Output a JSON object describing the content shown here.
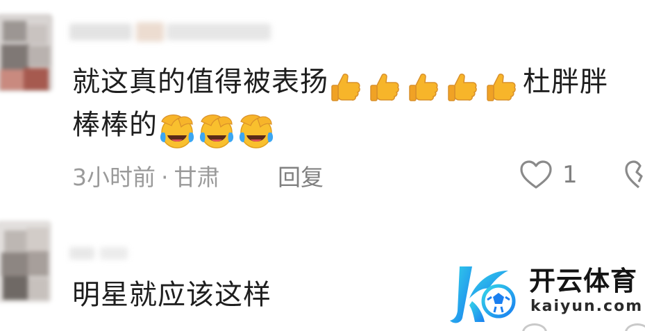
{
  "comments": [
    {
      "text_line1": "就这真的值得被表扬",
      "text_line1_tail": "杜胖胖",
      "text_line2": "棒棒的",
      "thumbs_emoji_count": 5,
      "laugh_emoji_count": 3,
      "meta_time": "3小时前",
      "meta_separator": "·",
      "meta_location": "甘肃",
      "reply_label": "回复",
      "like_count": "1"
    },
    {
      "text": "明星就应该这样"
    }
  ],
  "watermark": {
    "title": "开云体育",
    "url": "kaiyun.com"
  },
  "colors": {
    "text": "#1e1e1e",
    "meta": "#9a9a9a",
    "thumb": "#f7b52a",
    "logo_blue": "#1aa6f0",
    "logo_cyan": "#34d4e8"
  }
}
